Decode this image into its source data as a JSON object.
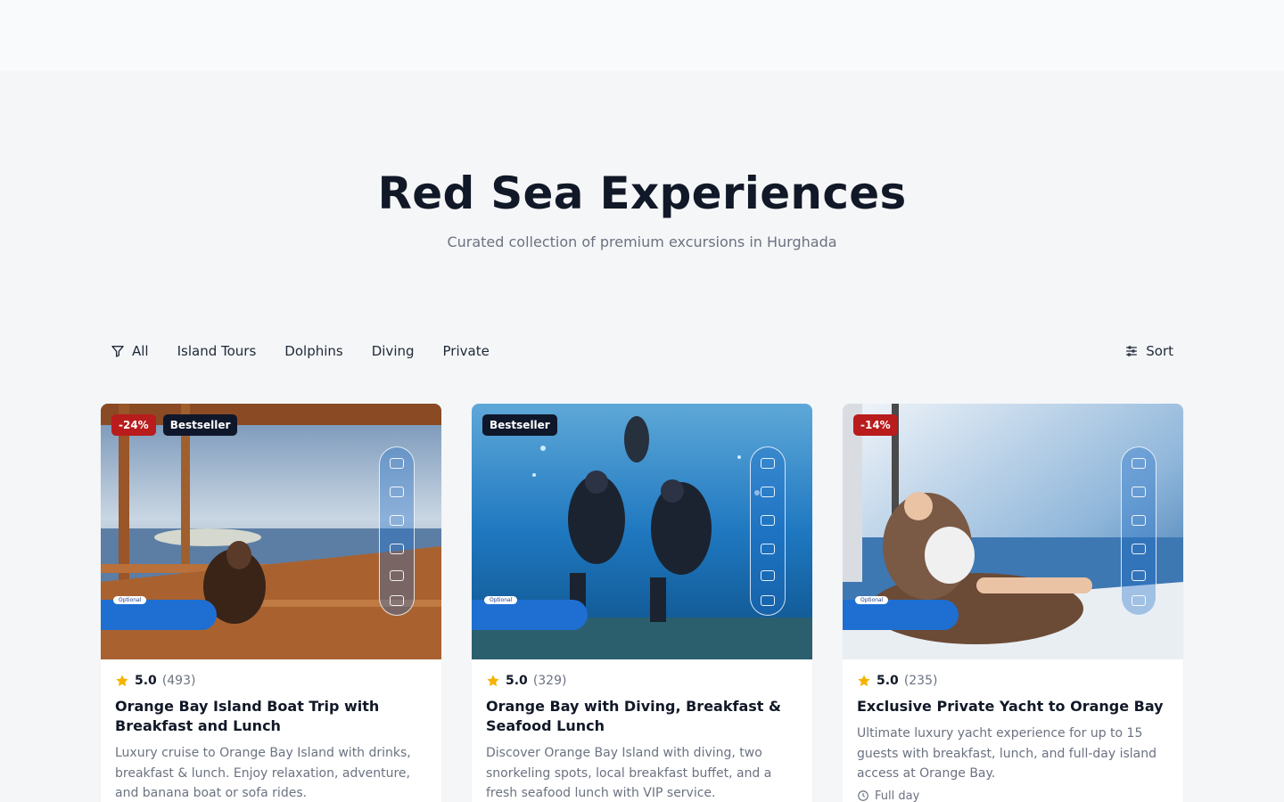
{
  "hero": {
    "title": "Red Sea Experiences",
    "subtitle": "Curated collection of premium excursions in Hurghada"
  },
  "filters": {
    "items": [
      {
        "label": "All",
        "icon": "filter-icon"
      },
      {
        "label": "Island Tours"
      },
      {
        "label": "Dolphins"
      },
      {
        "label": "Diving"
      },
      {
        "label": "Private"
      }
    ],
    "sort_label": "Sort",
    "sort_icon": "sliders-icon"
  },
  "colors": {
    "discount_badge": "#b91c1c",
    "bestseller_badge": "#0f172a",
    "star": "#f5b301",
    "accent_blue": "#1e6fd1"
  },
  "cards": [
    {
      "discount": "-24%",
      "bestseller": "Bestseller",
      "rating": "5.0",
      "reviews": "(493)",
      "title": "Orange Bay Island Boat Trip with Breakfast and Lunch",
      "description": "Luxury cruise to Orange Bay Island with drinks, breakfast & lunch. Enjoy relaxation, adventure, and banana boat or sofa rides.",
      "image_tag": "Optional"
    },
    {
      "bestseller": "Bestseller",
      "rating": "5.0",
      "reviews": "(329)",
      "title": "Orange Bay with Diving, Breakfast & Seafood Lunch",
      "description": "Discover Orange Bay Island with diving, two snorkeling spots, local breakfast buffet, and a fresh seafood lunch with VIP service.",
      "image_tag": "Optional"
    },
    {
      "discount": "-14%",
      "rating": "5.0",
      "reviews": "(235)",
      "title": "Exclusive Private Yacht to Orange Bay",
      "description": "Ultimate luxury yacht experience for up to 15 guests with breakfast, lunch, and full-day island access at Orange Bay.",
      "duration": "Full day",
      "image_tag": "Optional"
    }
  ]
}
